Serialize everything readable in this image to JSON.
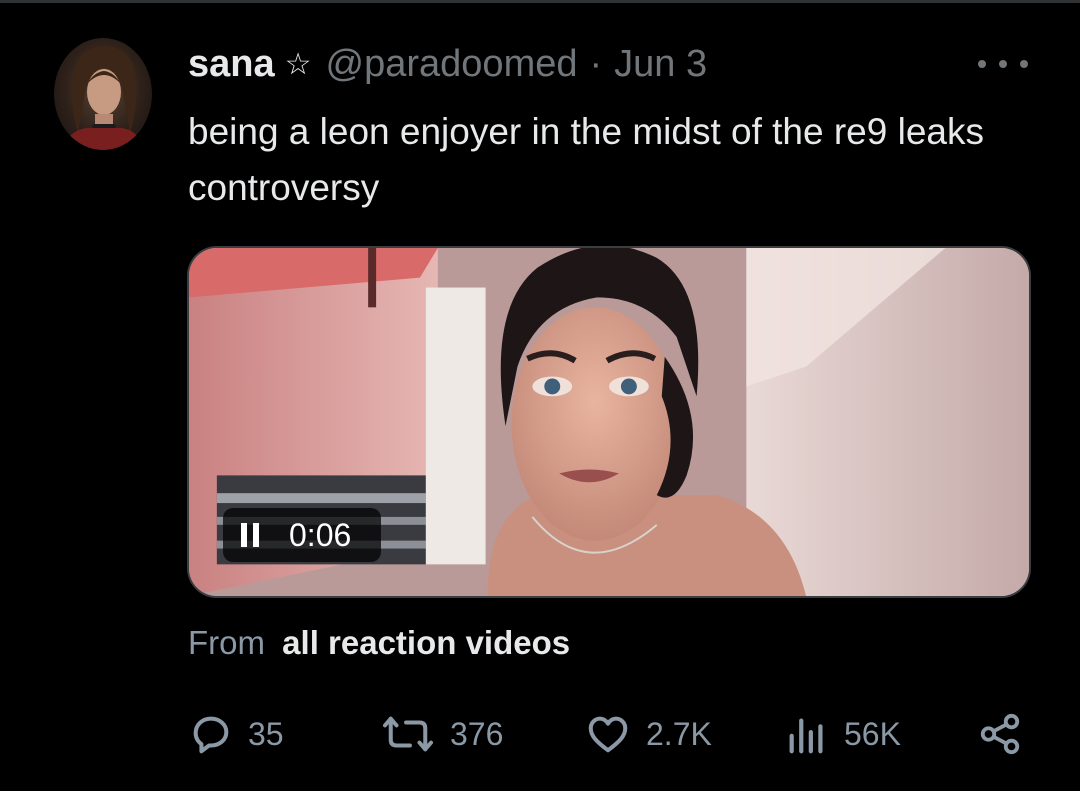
{
  "tweet": {
    "author": {
      "display_name": "sana",
      "badge_glyph": "☆",
      "handle": "@paradoomed",
      "separator": "·",
      "date": "Jun 3"
    },
    "text": "being a leon enjoyer in the midst of the re9 leaks controversy",
    "media": {
      "timecode": "0:06",
      "playback_state": "playing"
    },
    "attribution": {
      "prefix": "From",
      "source": "all reaction videos"
    },
    "metrics": {
      "replies": "35",
      "reposts": "376",
      "likes": "2.7K",
      "views": "56K"
    }
  },
  "icons": {
    "more": "more-horizontal-icon",
    "reply": "reply-icon",
    "repost": "repost-icon",
    "like": "heart-icon",
    "views": "views-icon",
    "share": "share-icon",
    "pause": "pause-icon"
  },
  "colors": {
    "background": "#000000",
    "primary_text": "#e7e9ea",
    "secondary_text": "#71767b",
    "action_gray": "#8b98a5",
    "media_border": "#3a3d41"
  }
}
